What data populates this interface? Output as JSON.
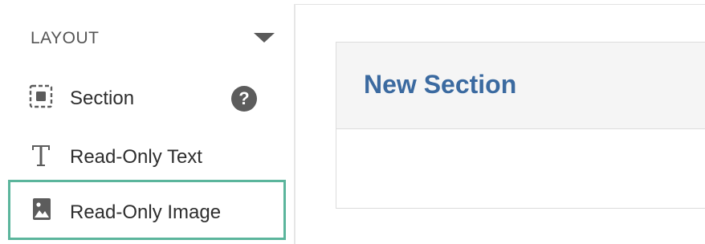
{
  "sidebar": {
    "header": {
      "label": "LAYOUT",
      "toggle_icon": "caret-down-icon"
    },
    "items": [
      {
        "label": "Section",
        "icon": "section-icon",
        "help_icon": "help-icon",
        "help_text": "?"
      },
      {
        "label": "Read-Only Text",
        "icon": "text-icon"
      },
      {
        "label": "Read-Only Image",
        "icon": "image-icon",
        "selected": true
      }
    ]
  },
  "canvas": {
    "section": {
      "title": "New Section"
    }
  },
  "colors": {
    "selection_border": "#5bb59c",
    "section_title": "#3b6aa0",
    "icon": "#5c5c5c"
  }
}
